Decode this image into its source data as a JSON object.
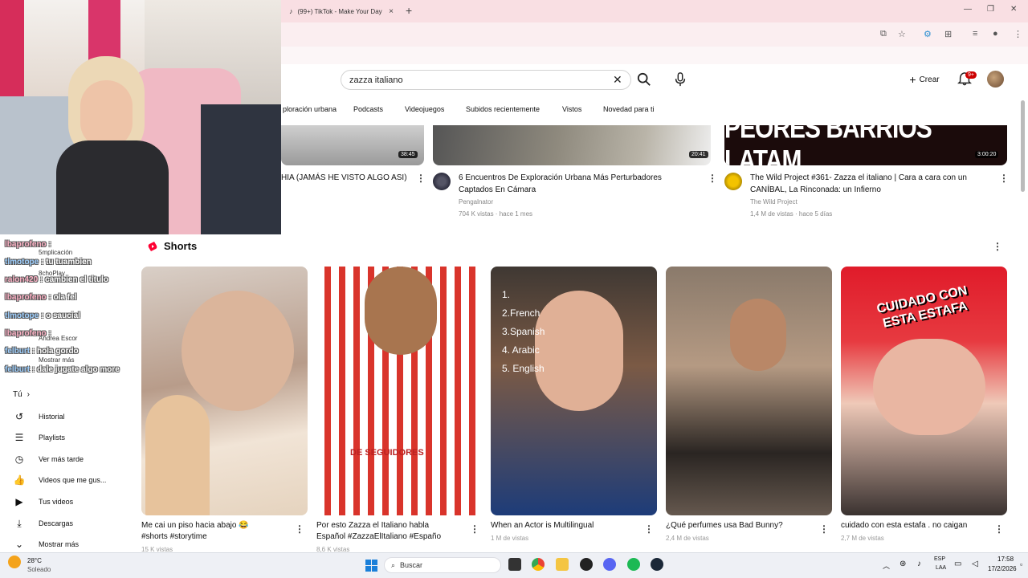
{
  "browser": {
    "tab_title": "(99+) TikTok - Make Your Day",
    "tab_close": "×",
    "new_tab": "+"
  },
  "youtube": {
    "search_value": "zazza italiano",
    "create_label": "Crear",
    "notif_badge": "9+",
    "chips": [
      "ploración urbana",
      "Podcasts",
      "Videojuegos",
      "Subidos recientemente",
      "Vistos",
      "Novedad para ti"
    ],
    "top_videos": [
      {
        "title": "HIA (JAMÁS HE VISTO ALGO ASI)",
        "duration": "38:45"
      },
      {
        "title_line1": "6 Encuentros De Exploración Urbana Más Perturbadores",
        "title_line2": "Captados En Cámara",
        "channel": "Pengalnator",
        "meta": "704 K vistas · hace 1 mes",
        "duration": "20:41"
      },
      {
        "title_line1": "The Wild Project #361- Zazza el italiano | Cara a cara con un",
        "title_line2": "CANÍBAL, La Rinconada: un Infierno",
        "channel": "The Wild Project",
        "meta": "1,4 M de vistas · hace 5 días",
        "thumb_text": "PEORES BARRIOS LATAM",
        "duration": "3:00:20"
      }
    ],
    "shorts_heading": "Shorts",
    "shorts": [
      {
        "title_line1": "Me cai un piso hacia abajo 😂",
        "title_line2": "#shorts #storytime",
        "meta": "15 K vistas"
      },
      {
        "title_line1": "Por esto Zazza el Italiano habla",
        "title_line2": "Español #ZazzaElItaliano #Españo",
        "meta": "8,6 K vistas",
        "overlay": "DE SEGUIDORES"
      },
      {
        "title_line1": "When an Actor is Multilingual",
        "meta": "1 M de vistas",
        "list": [
          "1.",
          "2.French",
          "3.Spanish",
          "4. Arabic",
          "5. English"
        ]
      },
      {
        "title_line1": "¿Qué perfumes usa Bad Bunny?",
        "meta": "2,4 M de vistas"
      },
      {
        "title_line1": "cuidado con esta estafa . no caigan",
        "meta": "2,7 M de vistas",
        "overlay": "CUIDADO CON ESTA ESTAFA"
      }
    ],
    "sidebar": {
      "you_label": "Tú",
      "items": [
        "Historial",
        "Playlists",
        "Ver más tarde",
        "Videos que me gus...",
        "Tus videos",
        "Descargas",
        "Mostrar más"
      ]
    }
  },
  "chat": [
    {
      "user": "lbaprofeno",
      "msg": ""
    },
    {
      "user": "tlmotope",
      "msg": "tu tuambien"
    },
    {
      "user": "ralon420",
      "msg": "cambien el titulo"
    },
    {
      "user": "lbaprofeno",
      "msg": "ola fel"
    },
    {
      "user": "tlmotope",
      "msg": "o saucial"
    },
    {
      "user": "lbaprofeno",
      "msg": ""
    },
    {
      "user": "felburt",
      "msg": "hola gordo"
    },
    {
      "user": "felburt",
      "msg": "dale jugate algo more"
    }
  ],
  "chat_bg": [
    "5mplicación",
    "8choPlay",
    "Andrea Escor",
    "Mostrar más"
  ],
  "weather": {
    "temp": "28°C",
    "condition": "Soleado"
  },
  "taskbar": {
    "search_label": "Buscar",
    "lang_top": "ESP",
    "lang_bottom": "LAA",
    "time": "17:58",
    "date": "17/2/2026"
  },
  "colors": {
    "yt_red": "#ff0033",
    "tab_pink": "#f9dfe3",
    "accent_blue": "#065fd4"
  }
}
